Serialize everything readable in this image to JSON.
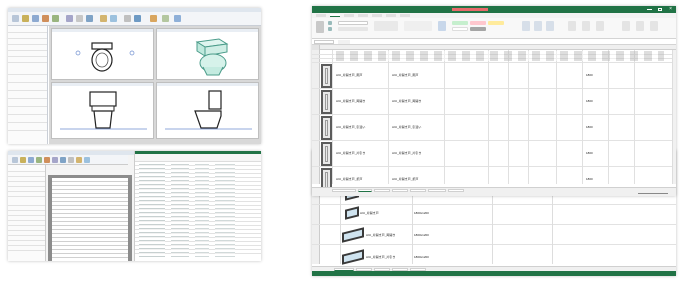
{
  "colors": {
    "excel_green": "#217346",
    "revit_ribbon": "#f3f5f8",
    "panel_bg": "#ffffff",
    "title_highlight": "#e86a6a"
  },
  "icons": [
    "toilet-icon",
    "door-icon",
    "window-icon"
  ],
  "revit_top": {
    "views": [
      "view-top-left",
      "view-top-right",
      "view-bottom-left",
      "view-bottom-right"
    ]
  },
  "excel_main": {
    "sheet_rows": [
      {
        "type": "AIU_片開き戸_雨戸",
        "width": "1800"
      },
      {
        "type": "AIU_片開き戸_両開き",
        "width": "1800"
      },
      {
        "type": "AIU_片開き戸_引違い",
        "width": "1800"
      },
      {
        "type": "AIU_片開き戸_片引き",
        "width": "1800"
      },
      {
        "type": "AIU_片開き戸_折戸",
        "width": "1800"
      },
      {
        "type": "AIU_片開き戸_開戸",
        "width": "1800"
      }
    ]
  },
  "excel_back": {
    "rows": [
      {
        "name": "AIU_片開き戸_雨戸",
        "size": "1800x1200"
      },
      {
        "name": "AIU_片開き戸",
        "size": "1800x1200"
      },
      {
        "name": "AIU_片開き戸_両開き",
        "size": "1800x1200"
      },
      {
        "name": "AIU_片開き戸_片引き",
        "size": "1800x1200"
      }
    ]
  }
}
